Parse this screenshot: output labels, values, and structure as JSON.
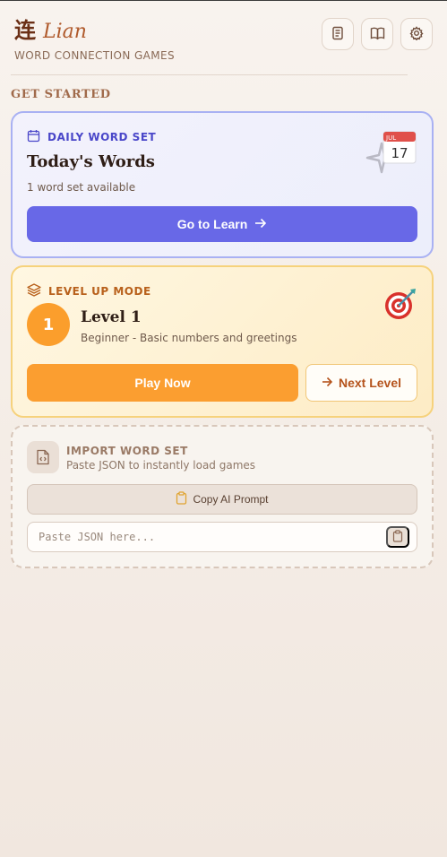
{
  "app": {
    "logo_char": "连",
    "name": "Lian",
    "tagline": "WORD CONNECTION GAMES"
  },
  "header_icons": [
    "notes-icon",
    "book-open-icon",
    "gear-icon"
  ],
  "section": {
    "title": "GET STARTED"
  },
  "daily": {
    "eyebrow": "DAILY WORD SET",
    "title": "Today's Words",
    "subtitle": "1 word set available",
    "button_label": "Go to Learn",
    "calendar_month": "JUL",
    "calendar_day": "17"
  },
  "level": {
    "eyebrow": "LEVEL UP MODE",
    "number": "1",
    "title": "Level 1",
    "subtitle": "Beginner - Basic numbers and greetings",
    "play_label": "Play Now",
    "next_label": "Next Level"
  },
  "import": {
    "title": "IMPORT WORD SET",
    "subtitle": "Paste JSON to instantly load games",
    "copy_label": "Copy AI Prompt",
    "input_placeholder": "Paste JSON here...",
    "input_value": ""
  },
  "colors": {
    "accent_indigo": "#6868e7",
    "accent_orange": "#fb9e2c",
    "brand_brown": "#6b2f16"
  }
}
